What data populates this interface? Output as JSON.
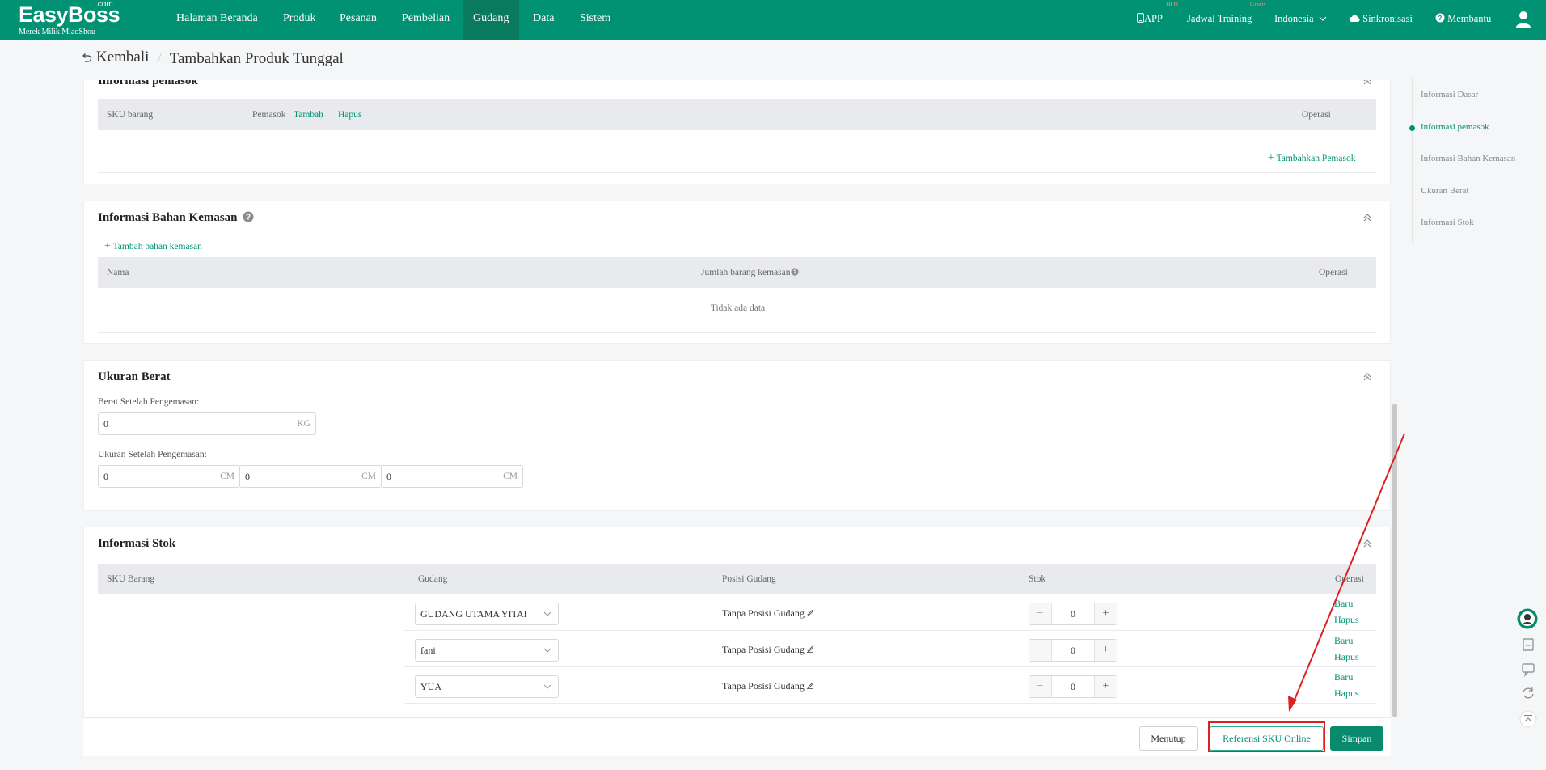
{
  "brand": {
    "name": "EasyBoss",
    "com": ".com",
    "tagline": "Merek Milik MiaoShou"
  },
  "nav": {
    "items": [
      "Halaman Beranda",
      "Produk",
      "Pesanan",
      "Pembelian",
      "Gudang",
      "Data",
      "Sistem"
    ],
    "active": "Gudang"
  },
  "topright": {
    "app": "APP",
    "app_badge": "HOT",
    "training": "Jadwal Training",
    "training_badge": "Gratis",
    "language": "Indonesia",
    "sync": "Sinkronisasi",
    "help": "Membantu"
  },
  "breadcrumb": {
    "back": "Kembali",
    "sep": "/",
    "current": "Tambahkan Produk Tunggal"
  },
  "supplier": {
    "title": "Informasi pemasok",
    "col_sku": "SKU barang",
    "col_supplier": "Pemasok",
    "add": "Tambah",
    "remove": "Hapus",
    "col_op": "Operasi",
    "add_supplier": "Tambahkan Pemasok"
  },
  "packaging": {
    "title": "Informasi Bahan Kemasan",
    "add": "Tambah bahan kemasan",
    "col_name": "Nama",
    "col_qty": "Jumlah barang kemasan",
    "col_op": "Operasi",
    "empty": "Tidak ada data"
  },
  "weight": {
    "title": "Ukuran Berat",
    "weight_label": "Berat Setelah Pengemasan:",
    "weight_value": "0",
    "weight_unit": "KG",
    "size_label": "Ukuran Setelah Pengemasan:",
    "length": "0",
    "width": "0",
    "height": "0",
    "size_unit": "CM"
  },
  "stock": {
    "title": "Informasi Stok",
    "col_sku": "SKU Barang",
    "col_warehouse": "Gudang",
    "col_position": "Posisi Gudang",
    "col_stock": "Stok",
    "col_op": "Operasi",
    "rows": [
      {
        "warehouse": "GUDANG UTAMA YITAI",
        "position": "Tanpa Posisi Gudang",
        "stock": "0",
        "op_new": "Baru",
        "op_delete": "Hapus"
      },
      {
        "warehouse": "fani",
        "position": "Tanpa Posisi Gudang",
        "stock": "0",
        "op_new": "Baru",
        "op_delete": "Hapus"
      },
      {
        "warehouse": "YUA",
        "position": "Tanpa Posisi Gudang",
        "stock": "0",
        "op_new": "Baru",
        "op_delete": "Hapus"
      }
    ]
  },
  "anchors": {
    "items": [
      "Informasi Dasar",
      "Informasi pemasok",
      "Informasi Bahan Kemasan",
      "Ukuran Berat",
      "Informasi Stok"
    ],
    "active": "Informasi pemasok"
  },
  "footer": {
    "close": "Menutup",
    "reference": "Referensi SKU Online",
    "save": "Simpan"
  },
  "colors": {
    "brand": "#009273",
    "highlight": "#e02020"
  }
}
